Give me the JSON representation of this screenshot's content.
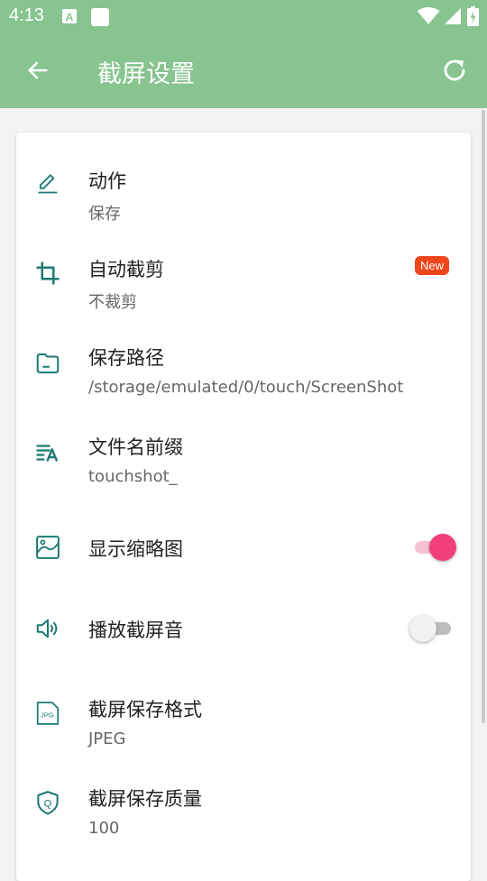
{
  "status_bar": {
    "time": "4:13"
  },
  "app_bar": {
    "title": "截屏设置",
    "back_icon": "arrow-back-icon",
    "refresh_icon": "refresh-icon"
  },
  "colors": {
    "app_bar": "#87c48f",
    "accent_icon": "#1c7a72",
    "toggle_on": "#f2407a",
    "badge": "#f0461b"
  },
  "settings": [
    {
      "icon": "pencil-icon",
      "title": "动作",
      "value": "保存"
    },
    {
      "icon": "crop-icon",
      "title": "自动截剪",
      "value": "不裁剪",
      "badge": "New"
    },
    {
      "icon": "folder-icon",
      "title": "保存路径",
      "value": "/storage/emulated/0/touch/ScreenShot"
    },
    {
      "icon": "text-format-icon",
      "title": "文件名前缀",
      "value": "touchshot_"
    },
    {
      "icon": "image-icon",
      "title": "显示缩略图",
      "toggle": true
    },
    {
      "icon": "speaker-icon",
      "title": "播放截屏音",
      "toggle": false
    },
    {
      "icon": "jpg-file-icon",
      "title": "截屏保存格式",
      "value": "JPEG"
    },
    {
      "icon": "quality-shield-icon",
      "title": "截屏保存质量",
      "value": "100"
    }
  ]
}
